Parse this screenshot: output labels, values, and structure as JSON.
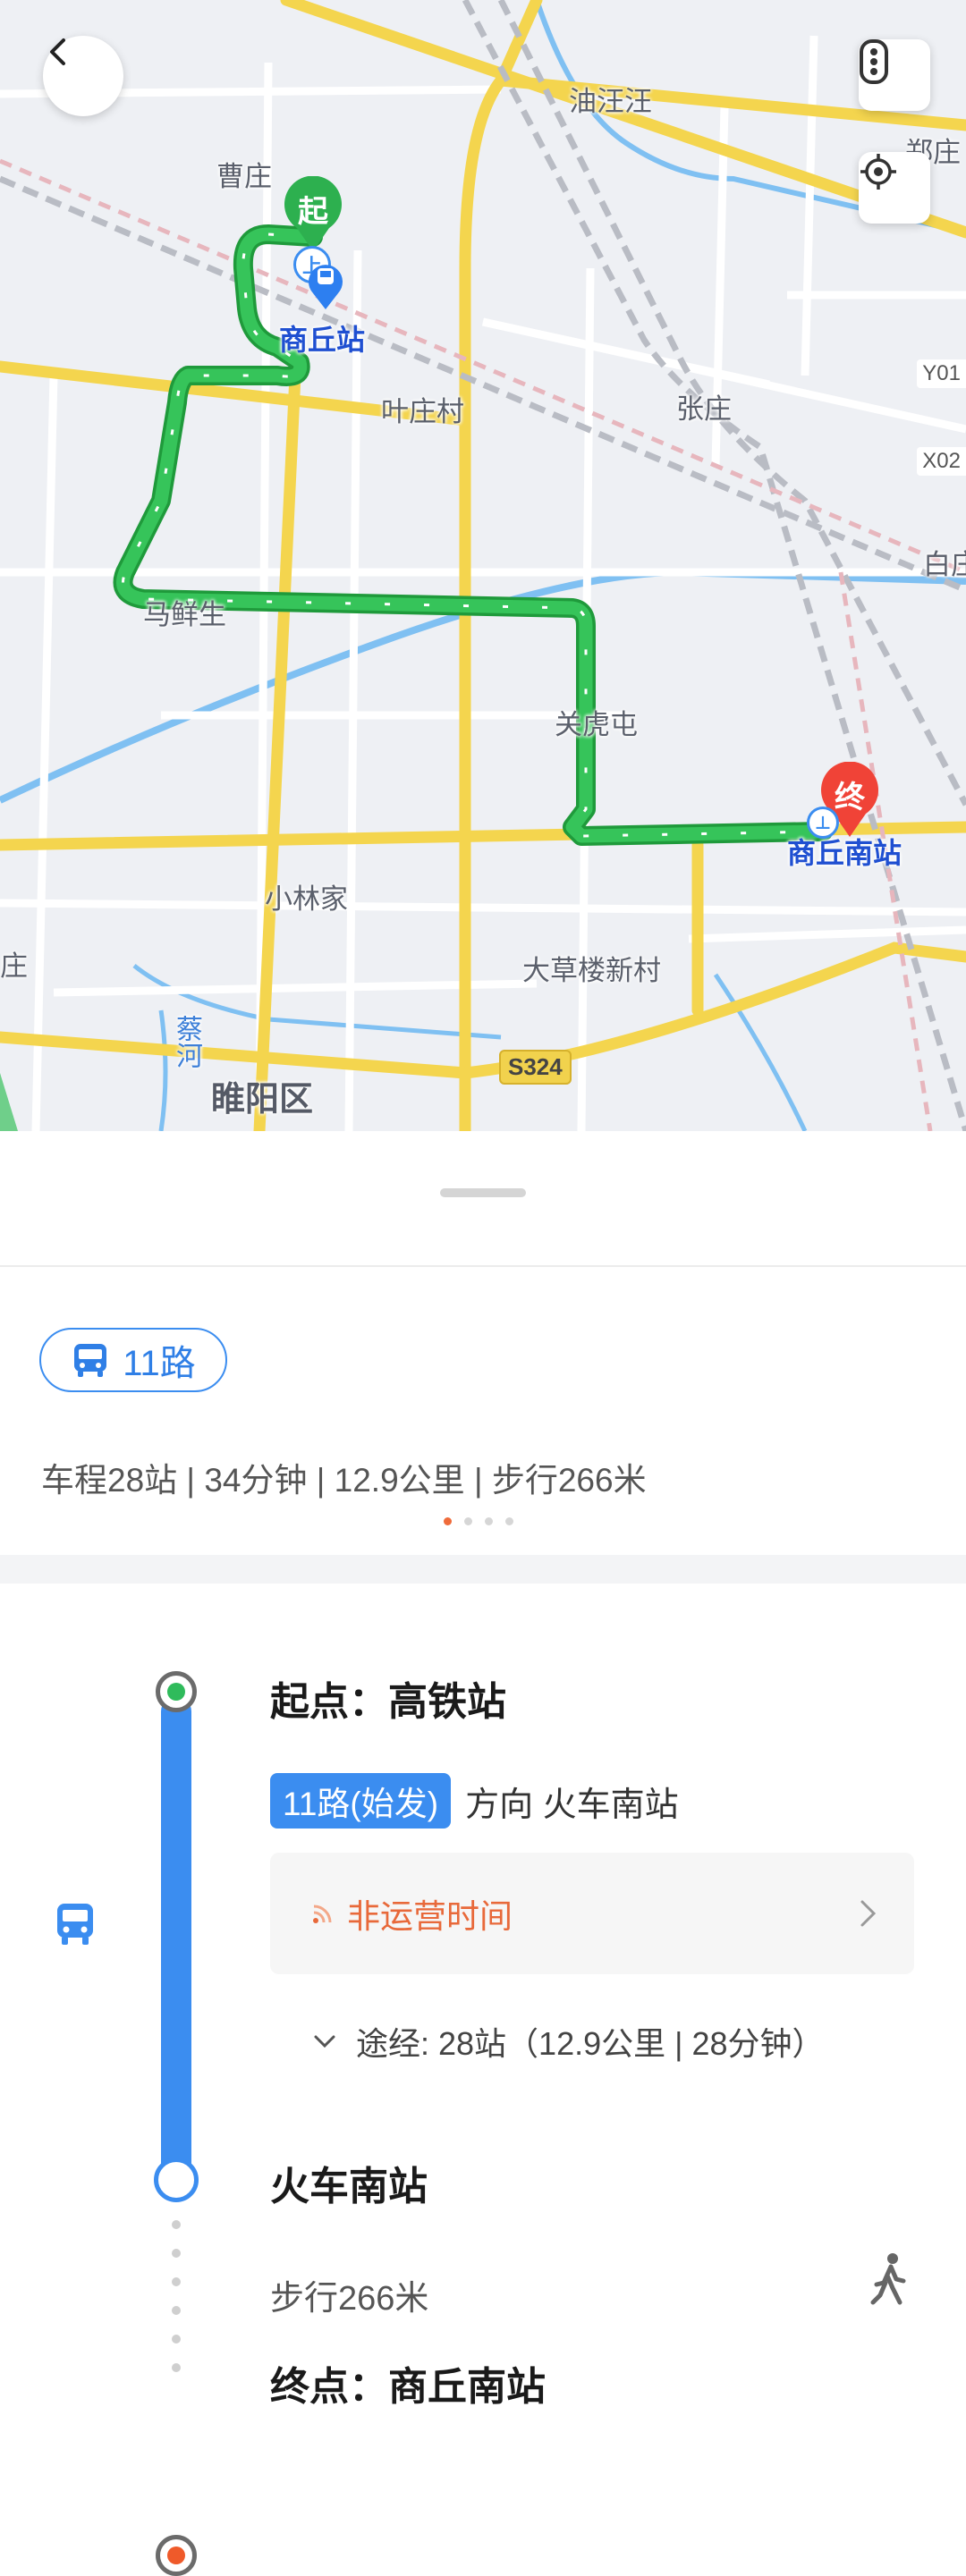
{
  "map": {
    "places": {
      "caozhuang": "曹庄",
      "youwangwang": "油汪汪",
      "yingzhuang": "郑庄",
      "yezhuangcun": "叶庄村",
      "zhangzhuang": "张庄",
      "baizhuang": "白庄",
      "maxiansheng": "马鲜生",
      "guanhutun": "关虎屯",
      "xiaolinjia": "小林家",
      "dacaolou": "大草楼新村",
      "zhuang_left": "庄",
      "caihe": "蔡河",
      "suiyang": "睢阳区"
    },
    "stations": {
      "start_station": "商丘站",
      "end_station": "商丘南站"
    },
    "markers": {
      "start": "起",
      "end": "终",
      "board": "上"
    },
    "roads": {
      "s324": "S324",
      "y01": "Y01",
      "x02": "X02"
    }
  },
  "sheet": {
    "route_chip": "11路",
    "summary": "车程28站 | 34分钟 | 12.9公里 | 步行266米",
    "start_title": "起点：高铁站",
    "line_tag": "11路(始发)",
    "direction": "方向 火车南站",
    "status": "非运营时间",
    "via": "途经: 28站（12.9公里 | 28分钟）",
    "alight_station": "火车南站",
    "walk": "步行266米",
    "end_title": "终点：商丘南站"
  },
  "colors": {
    "route": "#2fbb4f",
    "bus_line": "#3b8df0",
    "warning": "#e8693a",
    "end_marker": "#f04337"
  }
}
